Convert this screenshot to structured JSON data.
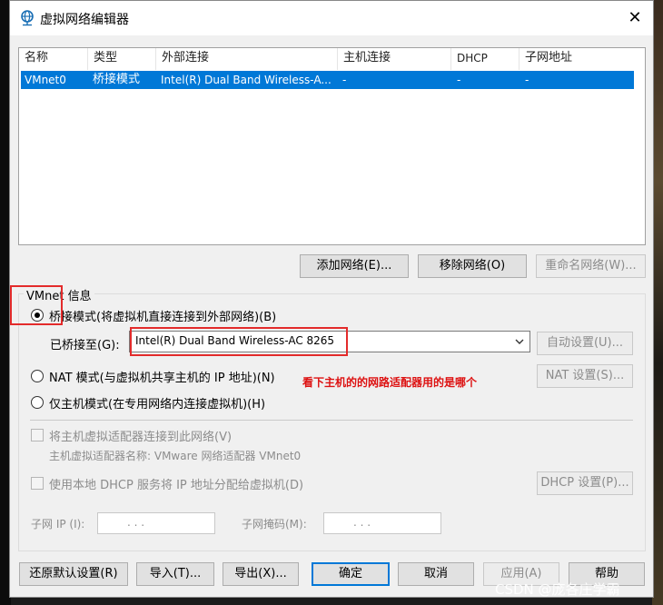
{
  "window": {
    "title": "虚拟网络编辑器",
    "close_glyph": "✕"
  },
  "network_list": {
    "columns": [
      "名称",
      "类型",
      "外部连接",
      "主机连接",
      "DHCP",
      "子网地址"
    ],
    "rows": [
      {
        "name": "VMnet0",
        "type": "桥接模式",
        "external": "Intel(R) Dual Band Wireless-A...",
        "host": "-",
        "dhcp": "-",
        "subnet": "-"
      }
    ]
  },
  "list_buttons": {
    "add": "添加网络(E)...",
    "remove": "移除网络(O)",
    "rename": "重命名网络(W)..."
  },
  "vmnet_info": {
    "group_label": "VMnet 信息",
    "bridged_label": "桥接模式(将虚拟机直接连接到外部网络)(B)",
    "bridge_to_label": "已桥接至(G):",
    "bridge_to_value": "Intel(R) Dual Band Wireless-AC 8265",
    "auto_settings": "自动设置(U)...",
    "nat_label": "NAT 模式(与虚拟机共享主机的 IP 地址)(N)",
    "nat_settings": "NAT 设置(S)...",
    "hostonly_label": "仅主机模式(在专用网络内连接虚拟机)(H)",
    "connect_adapter_label": "将主机虚拟适配器连接到此网络(V)",
    "adapter_name_label": "主机虚拟适配器名称: VMware 网络适配器 VMnet0",
    "dhcp_label": "使用本地 DHCP 服务将 IP 地址分配给虚拟机(D)",
    "dhcp_settings": "DHCP 设置(P)...",
    "subnet_ip_label": "子网 IP (I):",
    "subnet_mask_label": "子网掩码(M):",
    "ip_dots": ".    .    .",
    "mask_dots": ".    .    ."
  },
  "annotation": {
    "text": "看下主机的的网路适配器用的是哪个",
    "color": "#d11111"
  },
  "bottom_buttons": {
    "restore": "还原默认设置(R)",
    "import": "导入(T)...",
    "export": "导出(X)...",
    "ok": "确定",
    "cancel": "取消",
    "apply": "应用(A)",
    "help": "帮助"
  },
  "watermark": "CSDN @庞各庄学霸",
  "colors": {
    "selection": "#0078d7",
    "accent": "#0078d7",
    "annotation": "#e32b2b"
  }
}
